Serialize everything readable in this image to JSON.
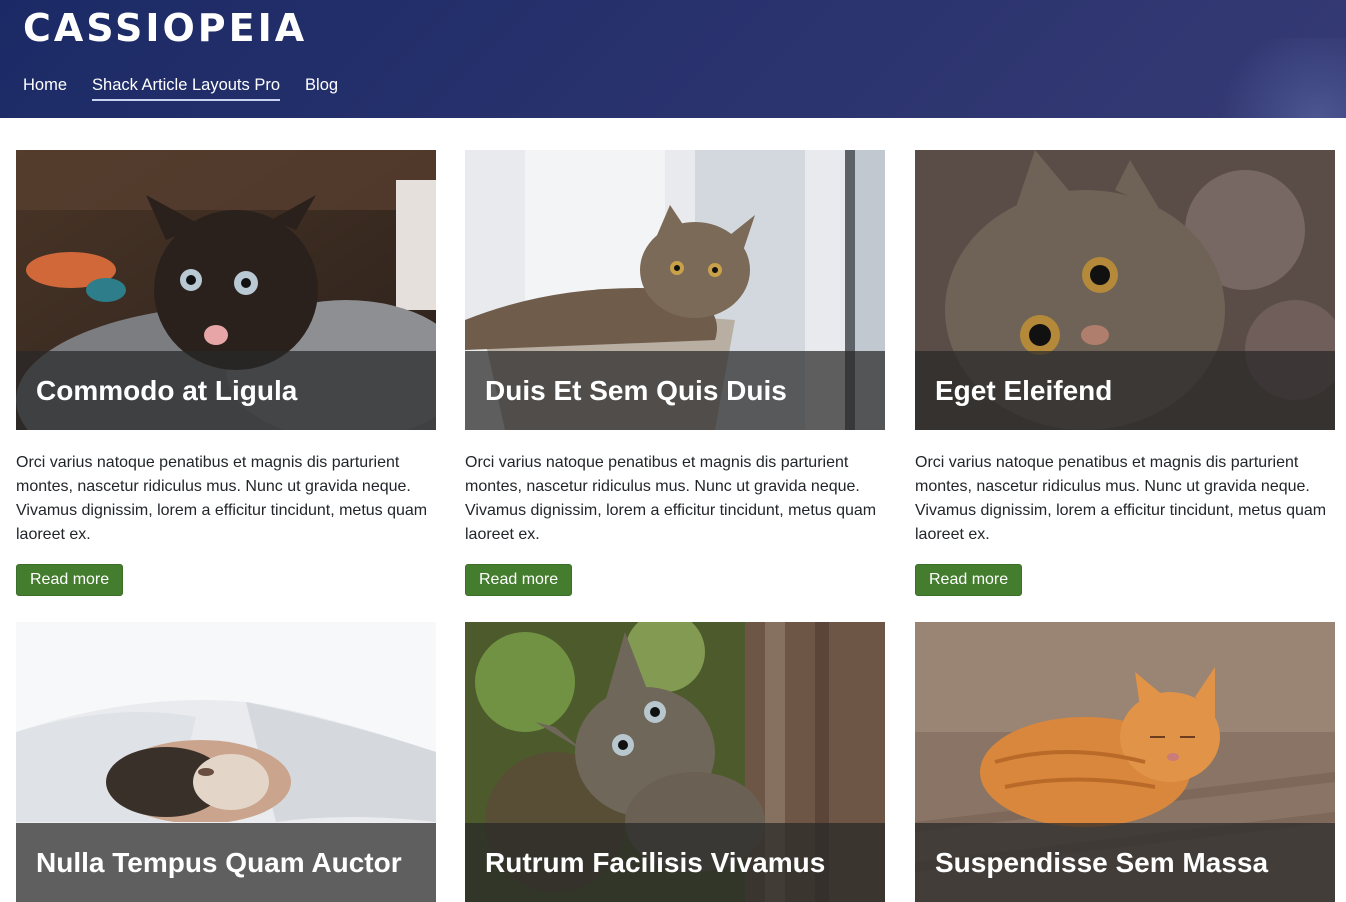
{
  "site": {
    "brand": "CASSIOPEIA",
    "nav": [
      {
        "label": "Home",
        "active": false
      },
      {
        "label": "Shack Article Layouts Pro",
        "active": true
      },
      {
        "label": "Blog",
        "active": false
      }
    ]
  },
  "articles": [
    {
      "title": "Commodo at Ligula",
      "excerpt": "Orci varius natoque penatibus et magnis dis parturient montes, nascetur ridiculus mus. Nunc ut gravida neque. Vivamus dignissim, lorem a efficitur tincidunt, metus quam laoreet ex.",
      "button": "Read more",
      "image": "black-kitten-on-blanket"
    },
    {
      "title": "Duis Et Sem Quis Duis",
      "excerpt": "Orci varius natoque penatibus et magnis dis parturient montes, nascetur ridiculus mus. Nunc ut gravida neque. Vivamus dignissim, lorem a efficitur tincidunt, metus quam laoreet ex.",
      "button": "Read more",
      "image": "tabby-cat-in-basket-by-window"
    },
    {
      "title": "Eget Eleifend",
      "excerpt": "Orci varius natoque penatibus et magnis dis parturient montes, nascetur ridiculus mus. Nunc ut gravida neque. Vivamus dignissim, lorem a efficitur tincidunt, metus quam laoreet ex.",
      "button": "Read more",
      "image": "tabby-cat-closeup"
    },
    {
      "title": "Nulla Tempus Quam Auctor",
      "excerpt": "",
      "button": "",
      "image": "cat-sleeping-under-duvet"
    },
    {
      "title": "Rutrum Facilisis Vivamus",
      "excerpt": "",
      "button": "",
      "image": "tabby-kitten-by-tree"
    },
    {
      "title": "Suspendisse Sem Massa",
      "excerpt": "",
      "button": "",
      "image": "orange-cat-on-floor"
    }
  ],
  "colors": {
    "header": "#2a336e",
    "button": "#457d2e",
    "overlay": "#282828"
  }
}
